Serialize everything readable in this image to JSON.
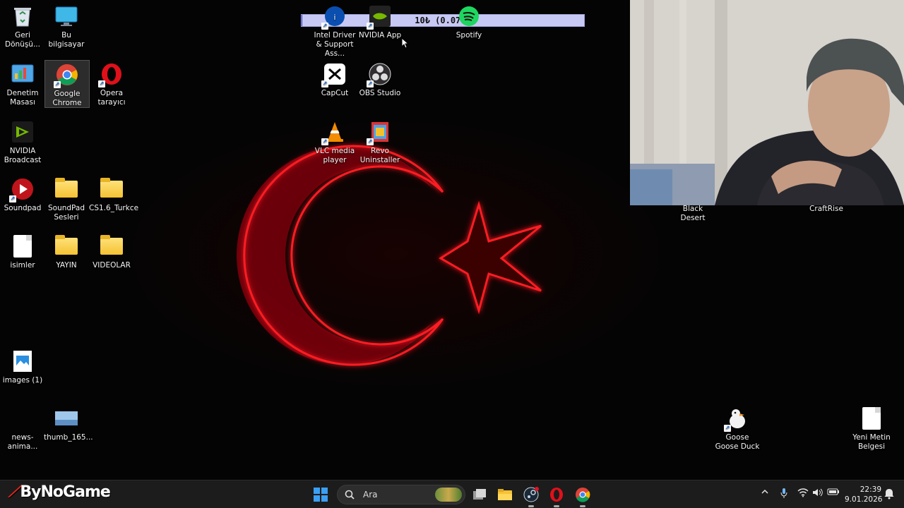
{
  "progress": {
    "text": "10₺ (0.07%)",
    "percent": 0.07
  },
  "desktop_icons": [
    {
      "id": "recycle-bin",
      "label": "Geri Dönüşü...",
      "icon": "recycle-bin-icon"
    },
    {
      "id": "this-pc",
      "label": "Bu bilgisayar",
      "icon": "monitor-icon"
    },
    {
      "id": "intel-driver",
      "label": "Intel Driver & Support Ass...",
      "icon": "intel-icon"
    },
    {
      "id": "nvidia-app",
      "label": "NVIDIA App",
      "icon": "nvidia-icon"
    },
    {
      "id": "spotify",
      "label": "Spotify",
      "icon": "spotify-icon"
    },
    {
      "id": "control-panel",
      "label": "Denetim Masası",
      "icon": "control-panel-icon"
    },
    {
      "id": "google-chrome",
      "label": "Google Chrome",
      "icon": "chrome-icon"
    },
    {
      "id": "opera",
      "label": "Opera tarayıcı",
      "icon": "opera-icon"
    },
    {
      "id": "capcut",
      "label": "CapCut",
      "icon": "capcut-icon"
    },
    {
      "id": "obs-studio",
      "label": "OBS Studio",
      "icon": "obs-icon"
    },
    {
      "id": "nvidia-broadcast",
      "label": "NVIDIA Broadcast",
      "icon": "nvidia-broadcast-icon"
    },
    {
      "id": "vlc",
      "label": "VLC media player",
      "icon": "vlc-cone-icon"
    },
    {
      "id": "revo",
      "label": "Revo Uninstaller",
      "icon": "revo-icon"
    },
    {
      "id": "soundpad",
      "label": "Soundpad",
      "icon": "soundpad-icon"
    },
    {
      "id": "soundpad-sesleri",
      "label": "SoundPad Sesleri",
      "icon": "folder-icon"
    },
    {
      "id": "cs16",
      "label": "CS1.6_Turkce",
      "icon": "folder-icon"
    },
    {
      "id": "isimler",
      "label": "isimler",
      "icon": "text-file-icon"
    },
    {
      "id": "yayin",
      "label": "YAYIN",
      "icon": "folder-icon"
    },
    {
      "id": "videolar",
      "label": "VIDEOLAR",
      "icon": "folder-icon"
    },
    {
      "id": "images",
      "label": "images (1)",
      "icon": "image-file-icon"
    },
    {
      "id": "news-anima",
      "label": "news-anima...",
      "icon": "image-file-icon"
    },
    {
      "id": "thumb",
      "label": "thumb_165...",
      "icon": "image-thumbnail-icon"
    },
    {
      "id": "black-desert",
      "label": "Black Desert",
      "icon": "game-icon"
    },
    {
      "id": "craftrise",
      "label": "CraftRise",
      "icon": "game-icon"
    },
    {
      "id": "goose",
      "label": "Goose Goose Duck",
      "icon": "goose-icon"
    },
    {
      "id": "yeni-metin",
      "label": "Yeni Metin Belgesi",
      "icon": "text-file-icon"
    }
  ],
  "taskbar": {
    "brand": "ByNoGame",
    "search_placeholder": "Ara",
    "clock_time": "22:39",
    "clock_date": "9.01.2026",
    "apps": [
      "windows-start-icon",
      "search-icon",
      "task-view-icon",
      "file-explorer-icon",
      "steam-icon",
      "opera-icon",
      "chrome-icon"
    ],
    "tray": [
      "chevron-up-icon",
      "microphone-icon",
      "wifi-icon",
      "speaker-icon",
      "battery-icon",
      "notification-icon"
    ]
  },
  "colors": {
    "wallpaper_red": "#e0101a",
    "accent_blue": "#3aa0f3",
    "progress_bg": "#c8c8f4"
  }
}
